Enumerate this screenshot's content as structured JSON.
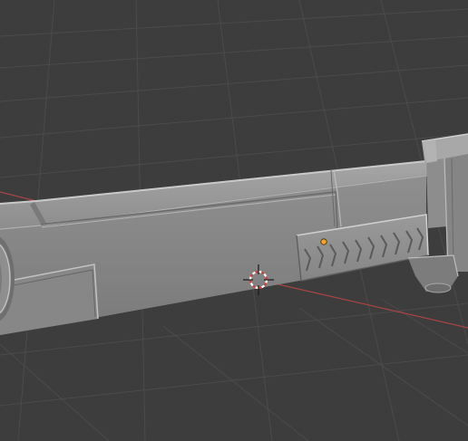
{
  "viewport": {
    "background_color": "#3d3d3d",
    "grid_color": "#4a4a4a",
    "x_axis_color": "#b54646"
  },
  "object": {
    "type": "hard-surface rifle barrel mesh",
    "base_color": "#8a8a8a",
    "highlight_color": "#a9a9a9",
    "shadow_color": "#5c5c5c",
    "edge_color": "#c4c4c4"
  },
  "cursor": {
    "icon": "3d-cursor-icon",
    "ring_colors": [
      "#d43c3c",
      "#ffffff"
    ]
  },
  "origin": {
    "icon": "object-origin-dot-icon",
    "color": "#f5a623"
  }
}
